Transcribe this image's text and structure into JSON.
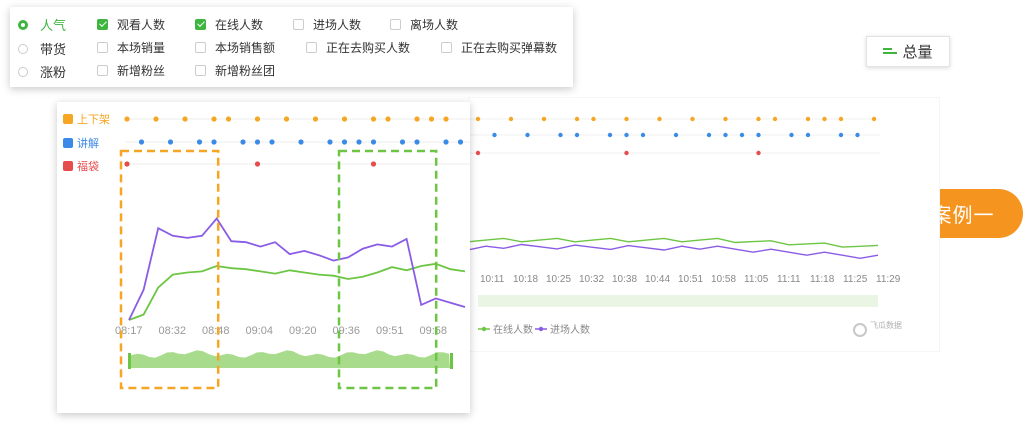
{
  "filters": {
    "radios": [
      {
        "label": "人气",
        "selected": true
      },
      {
        "label": "带货",
        "selected": false
      },
      {
        "label": "涨粉",
        "selected": false
      }
    ],
    "checkboxes": [
      {
        "label": "观看人数",
        "checked": true
      },
      {
        "label": "在线人数",
        "checked": true
      },
      {
        "label": "进场人数",
        "checked": false
      },
      {
        "label": "离场人数",
        "checked": false
      },
      {
        "label": "本场销量",
        "checked": false
      },
      {
        "label": "本场销售额",
        "checked": false
      },
      {
        "label": "正在去购买人数",
        "checked": false
      },
      {
        "label": "正在去购买弹幕数",
        "checked": false
      },
      {
        "label": "新增粉丝",
        "checked": false
      },
      {
        "label": "新增粉丝团",
        "checked": false
      }
    ]
  },
  "total_button": {
    "label": "总量",
    "icon": "sort-lines-icon"
  },
  "case_badge": "案例一",
  "colors": {
    "green": "#6cc644",
    "purple": "#8a5ce6",
    "orange": "#f5a623",
    "blue": "#3c8ae8",
    "red": "#e64c4c",
    "accent": "#3eb53e"
  },
  "events_legend": [
    {
      "label": "上下架",
      "color": "#f5a623",
      "icon": "cart-icon"
    },
    {
      "label": "讲解",
      "color": "#3c8ae8",
      "icon": "mic-icon"
    },
    {
      "label": "福袋",
      "color": "#e64c4c",
      "icon": "bag-icon"
    }
  ],
  "background_chart": {
    "x_ticks": [
      "10:11",
      "10:18",
      "10:25",
      "10:32",
      "10:38",
      "10:44",
      "10:51",
      "10:58",
      "11:05",
      "11:11",
      "11:18",
      "11:25",
      "11:29"
    ],
    "legend": [
      "在线人数",
      "进场人数"
    ],
    "watermark": "飞瓜数据"
  },
  "chart_data": {
    "type": "line",
    "x": [
      "08:17",
      "08:32",
      "08:48",
      "09:04",
      "09:20",
      "09:36",
      "09:51",
      "09:58"
    ],
    "x_ticks_visible": [
      "08:17",
      "08:32",
      "08:48",
      "09:04",
      "09:20",
      "09:36",
      "09:51",
      "09:58"
    ],
    "series": [
      {
        "name": "在线人数",
        "color": "#6cc644",
        "values": [
          0,
          5,
          30,
          42,
          44,
          45,
          50,
          48,
          47,
          45,
          43,
          46,
          44,
          42,
          41,
          38,
          40,
          44,
          49,
          46,
          50,
          52,
          47,
          45
        ]
      },
      {
        "name": "进场人数",
        "color": "#8a5ce6",
        "values": [
          0,
          28,
          85,
          78,
          76,
          78,
          94,
          73,
          72,
          68,
          72,
          61,
          64,
          60,
          55,
          58,
          66,
          70,
          68,
          75,
          14,
          20,
          16,
          12
        ]
      }
    ],
    "markers": {
      "上下架": [
        0,
        2,
        4,
        6,
        7,
        9,
        11,
        13,
        15,
        17,
        18,
        20,
        21,
        22,
        24
      ],
      "讲解": [
        1,
        3,
        5,
        6,
        8,
        9,
        10,
        12,
        14,
        15,
        16,
        17,
        19,
        20,
        22,
        23
      ],
      "福袋": [
        0,
        9,
        17
      ]
    },
    "highlights": [
      {
        "label": "",
        "color": "#f5a623",
        "from": "08:17",
        "to": "08:48"
      },
      {
        "label": "",
        "color": "#6cc644",
        "from": "09:36",
        "to": "09:58"
      }
    ]
  }
}
